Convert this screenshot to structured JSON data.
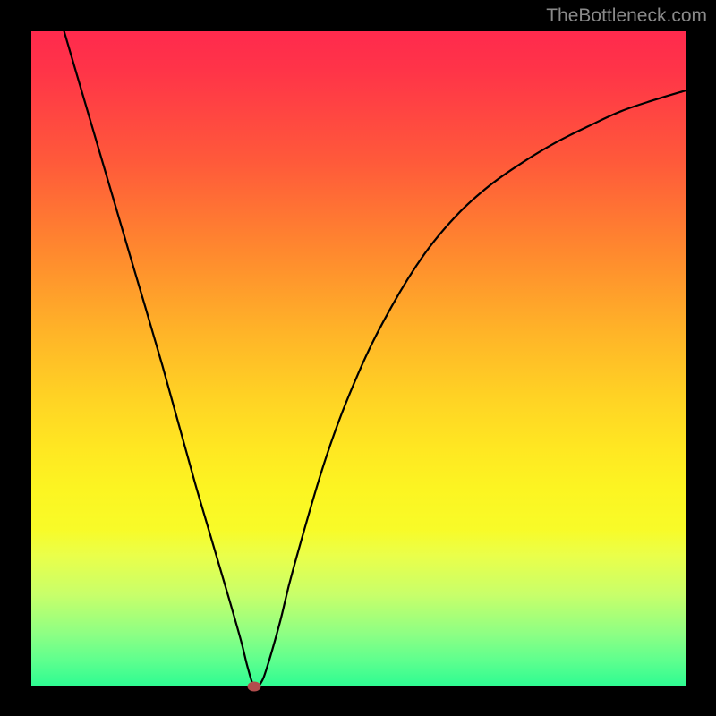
{
  "watermark": "TheBottleneck.com",
  "chart_data": {
    "type": "line",
    "title": "",
    "xlabel": "",
    "ylabel": "",
    "xlim": [
      0,
      100
    ],
    "ylim": [
      0,
      100
    ],
    "minimum_point": {
      "x": 34,
      "y": 0
    },
    "series": [
      {
        "name": "curve",
        "x": [
          5,
          10,
          15,
          20,
          25,
          30,
          32,
          33,
          34,
          35,
          36,
          38,
          40,
          45,
          50,
          55,
          60,
          65,
          70,
          75,
          80,
          85,
          90,
          95,
          100
        ],
        "y": [
          100,
          83,
          66,
          49,
          31,
          14,
          7,
          3,
          0,
          0.5,
          3,
          10,
          18,
          35,
          48,
          58,
          66,
          72,
          76.5,
          80,
          83,
          85.5,
          87.8,
          89.5,
          91
        ]
      }
    ],
    "marker": {
      "x": 34,
      "y": 0,
      "color": "#b24d4d"
    },
    "background_gradient": [
      "#ff2a4d",
      "#ffd324",
      "#fcf522",
      "#2dfc92"
    ]
  }
}
